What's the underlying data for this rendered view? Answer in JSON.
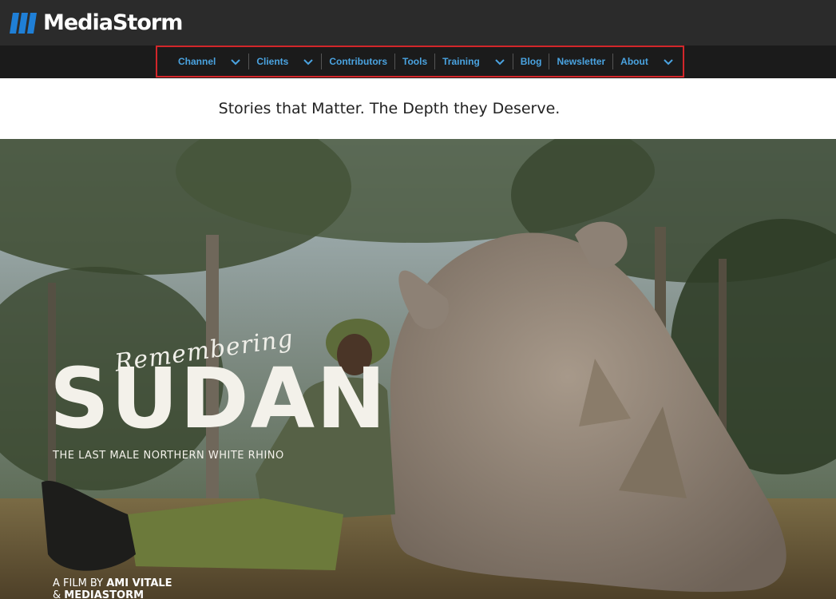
{
  "brand": {
    "name": "MediaStorm",
    "logo_color": "#1f7fd6"
  },
  "nav": {
    "items": [
      {
        "label": "Channel",
        "dropdown": true
      },
      {
        "label": "Clients",
        "dropdown": true
      },
      {
        "label": "Contributors",
        "dropdown": false
      },
      {
        "label": "Tools",
        "dropdown": false
      },
      {
        "label": "Training",
        "dropdown": true
      },
      {
        "label": "Blog",
        "dropdown": false
      },
      {
        "label": "Newsletter",
        "dropdown": false
      },
      {
        "label": "About",
        "dropdown": true
      }
    ],
    "link_color": "#4aa3e0",
    "highlight_color": "#d3262a"
  },
  "tagline": "Stories that Matter. The Depth they Deserve.",
  "hero": {
    "script_word": "Remembering",
    "title": "SUDAN",
    "subtitle": "THE LAST MALE NORTHERN WHITE RHINO",
    "credit_prefix": "A FILM BY",
    "credit_name": "AMI VITALE",
    "credit_prefix2": "&",
    "credit_name2": "MEDIASTORM"
  }
}
